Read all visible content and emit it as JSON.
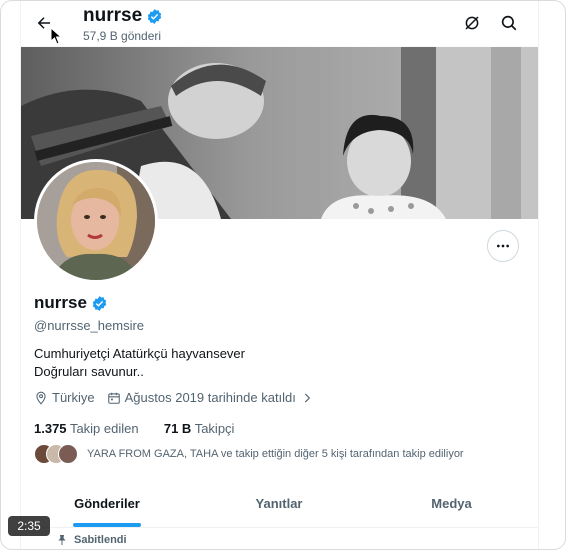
{
  "header": {
    "name": "nurrse",
    "posts_count": "57,9 B gönderi"
  },
  "profile": {
    "display_name": "nurrse",
    "handle": "@nurrsse_hemsire",
    "bio_line1": "Cumhuriyetçi Atatürkçü hayvansever",
    "bio_line2": "Doğruları savunur..",
    "location": "Türkiye",
    "joined": "Ağustos 2019 tarihinde katıldı",
    "following_count": "1.375",
    "following_label": "Takip edilen",
    "followers_count": "71 B",
    "followers_label": "Takipçi",
    "followed_by_text": "YARA FROM GAZA, TAHA ve takip ettiğin diğer 5 kişi tarafından takip ediliyor"
  },
  "tabs": [
    {
      "label": "Gönderiler",
      "active": true
    },
    {
      "label": "Yanıtlar",
      "active": false
    },
    {
      "label": "Medya",
      "active": false
    }
  ],
  "pinned_label": "Sabitlendi",
  "video_time": "2:35",
  "colors": {
    "accent": "#1d9bf0",
    "text": "#0f1419",
    "secondary": "#536471"
  },
  "icons": [
    "back-arrow-icon",
    "grok-icon",
    "search-icon",
    "verified-badge-icon",
    "more-icon",
    "location-icon",
    "calendar-icon",
    "chevron-right-icon",
    "pin-icon"
  ]
}
